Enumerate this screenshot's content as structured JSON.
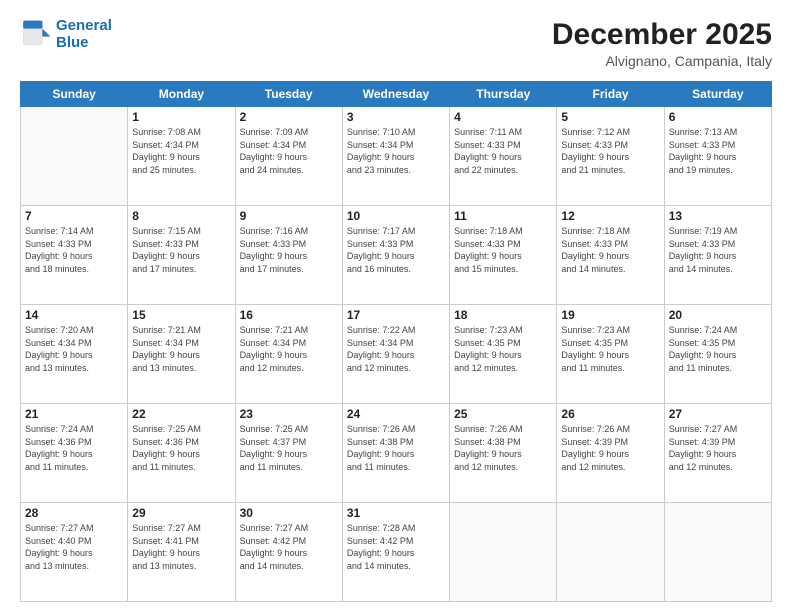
{
  "header": {
    "logo_line1": "General",
    "logo_line2": "Blue",
    "month_title": "December 2025",
    "location": "Alvignano, Campania, Italy"
  },
  "days_of_week": [
    "Sunday",
    "Monday",
    "Tuesday",
    "Wednesday",
    "Thursday",
    "Friday",
    "Saturday"
  ],
  "weeks": [
    [
      {
        "day": "",
        "info": ""
      },
      {
        "day": "1",
        "info": "Sunrise: 7:08 AM\nSunset: 4:34 PM\nDaylight: 9 hours\nand 25 minutes."
      },
      {
        "day": "2",
        "info": "Sunrise: 7:09 AM\nSunset: 4:34 PM\nDaylight: 9 hours\nand 24 minutes."
      },
      {
        "day": "3",
        "info": "Sunrise: 7:10 AM\nSunset: 4:34 PM\nDaylight: 9 hours\nand 23 minutes."
      },
      {
        "day": "4",
        "info": "Sunrise: 7:11 AM\nSunset: 4:33 PM\nDaylight: 9 hours\nand 22 minutes."
      },
      {
        "day": "5",
        "info": "Sunrise: 7:12 AM\nSunset: 4:33 PM\nDaylight: 9 hours\nand 21 minutes."
      },
      {
        "day": "6",
        "info": "Sunrise: 7:13 AM\nSunset: 4:33 PM\nDaylight: 9 hours\nand 19 minutes."
      }
    ],
    [
      {
        "day": "7",
        "info": "Sunrise: 7:14 AM\nSunset: 4:33 PM\nDaylight: 9 hours\nand 18 minutes."
      },
      {
        "day": "8",
        "info": "Sunrise: 7:15 AM\nSunset: 4:33 PM\nDaylight: 9 hours\nand 17 minutes."
      },
      {
        "day": "9",
        "info": "Sunrise: 7:16 AM\nSunset: 4:33 PM\nDaylight: 9 hours\nand 17 minutes."
      },
      {
        "day": "10",
        "info": "Sunrise: 7:17 AM\nSunset: 4:33 PM\nDaylight: 9 hours\nand 16 minutes."
      },
      {
        "day": "11",
        "info": "Sunrise: 7:18 AM\nSunset: 4:33 PM\nDaylight: 9 hours\nand 15 minutes."
      },
      {
        "day": "12",
        "info": "Sunrise: 7:18 AM\nSunset: 4:33 PM\nDaylight: 9 hours\nand 14 minutes."
      },
      {
        "day": "13",
        "info": "Sunrise: 7:19 AM\nSunset: 4:33 PM\nDaylight: 9 hours\nand 14 minutes."
      }
    ],
    [
      {
        "day": "14",
        "info": "Sunrise: 7:20 AM\nSunset: 4:34 PM\nDaylight: 9 hours\nand 13 minutes."
      },
      {
        "day": "15",
        "info": "Sunrise: 7:21 AM\nSunset: 4:34 PM\nDaylight: 9 hours\nand 13 minutes."
      },
      {
        "day": "16",
        "info": "Sunrise: 7:21 AM\nSunset: 4:34 PM\nDaylight: 9 hours\nand 12 minutes."
      },
      {
        "day": "17",
        "info": "Sunrise: 7:22 AM\nSunset: 4:34 PM\nDaylight: 9 hours\nand 12 minutes."
      },
      {
        "day": "18",
        "info": "Sunrise: 7:23 AM\nSunset: 4:35 PM\nDaylight: 9 hours\nand 12 minutes."
      },
      {
        "day": "19",
        "info": "Sunrise: 7:23 AM\nSunset: 4:35 PM\nDaylight: 9 hours\nand 11 minutes."
      },
      {
        "day": "20",
        "info": "Sunrise: 7:24 AM\nSunset: 4:35 PM\nDaylight: 9 hours\nand 11 minutes."
      }
    ],
    [
      {
        "day": "21",
        "info": "Sunrise: 7:24 AM\nSunset: 4:36 PM\nDaylight: 9 hours\nand 11 minutes."
      },
      {
        "day": "22",
        "info": "Sunrise: 7:25 AM\nSunset: 4:36 PM\nDaylight: 9 hours\nand 11 minutes."
      },
      {
        "day": "23",
        "info": "Sunrise: 7:25 AM\nSunset: 4:37 PM\nDaylight: 9 hours\nand 11 minutes."
      },
      {
        "day": "24",
        "info": "Sunrise: 7:26 AM\nSunset: 4:38 PM\nDaylight: 9 hours\nand 11 minutes."
      },
      {
        "day": "25",
        "info": "Sunrise: 7:26 AM\nSunset: 4:38 PM\nDaylight: 9 hours\nand 12 minutes."
      },
      {
        "day": "26",
        "info": "Sunrise: 7:26 AM\nSunset: 4:39 PM\nDaylight: 9 hours\nand 12 minutes."
      },
      {
        "day": "27",
        "info": "Sunrise: 7:27 AM\nSunset: 4:39 PM\nDaylight: 9 hours\nand 12 minutes."
      }
    ],
    [
      {
        "day": "28",
        "info": "Sunrise: 7:27 AM\nSunset: 4:40 PM\nDaylight: 9 hours\nand 13 minutes."
      },
      {
        "day": "29",
        "info": "Sunrise: 7:27 AM\nSunset: 4:41 PM\nDaylight: 9 hours\nand 13 minutes."
      },
      {
        "day": "30",
        "info": "Sunrise: 7:27 AM\nSunset: 4:42 PM\nDaylight: 9 hours\nand 14 minutes."
      },
      {
        "day": "31",
        "info": "Sunrise: 7:28 AM\nSunset: 4:42 PM\nDaylight: 9 hours\nand 14 minutes."
      },
      {
        "day": "",
        "info": ""
      },
      {
        "day": "",
        "info": ""
      },
      {
        "day": "",
        "info": ""
      }
    ]
  ]
}
